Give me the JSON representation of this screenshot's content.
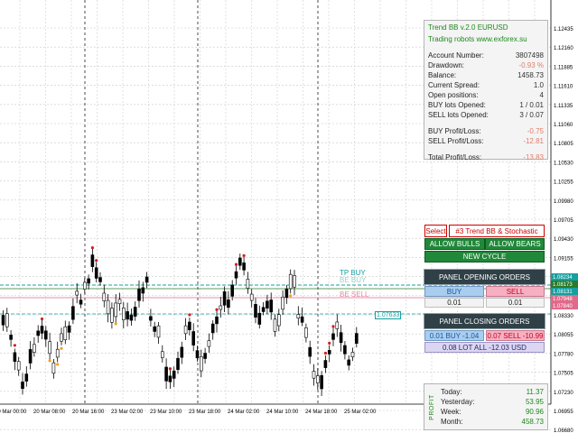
{
  "info_panel": {
    "title": "Trend BB v.2.0 EURUSD",
    "subtitle": "Trading robots www.exforex.su",
    "rows": [
      {
        "label": "Account Number:",
        "value": "3807498"
      },
      {
        "label": "Drawdown:",
        "value": "-0.93 %"
      },
      {
        "label": "Balance:",
        "value": "1458.73"
      },
      {
        "label": "Current Spread:",
        "value": "1.0"
      },
      {
        "label": "Open positions:",
        "value": "4"
      },
      {
        "label": "BUY lots Opened:",
        "value": "1 / 0.01"
      },
      {
        "label": "SELL lots Opened:",
        "value": "3 / 0.07"
      }
    ],
    "pl_rows": [
      {
        "label": "BUY Profit/Loss:",
        "value": "-0.75"
      },
      {
        "label": "SELL Profit/Loss:",
        "value": "-12.81"
      }
    ],
    "total": {
      "label": "Total Profit/Loss:",
      "value": "-13.83"
    }
  },
  "controls": {
    "select_label": "Select",
    "strategy_label": "#3 Trend BB & Stochastic",
    "allow_bulls": "ALLOW BULLS",
    "allow_bears": "ALLOW BEARS",
    "new_cycle": "NEW CYCLE"
  },
  "opening": {
    "header": "PANEL OPENING ORDERS",
    "buy": "BUY",
    "sell": "SELL",
    "buy_lot": "0.01",
    "sell_lot": "0.01"
  },
  "closing": {
    "header": "PANEL CLOSING ORDERS",
    "buy_close": "0.01 BUY  -1.04",
    "sell_close": "0.07 SELL  -10.99",
    "lot_all": "0.08 LOT     ALL     -12.03 USD"
  },
  "profit": {
    "vertical_label": "PROFIT",
    "rows": [
      {
        "label": "Today:",
        "value": "11.37"
      },
      {
        "label": "Yesterday:",
        "value": "53.95"
      },
      {
        "label": "Week:",
        "value": "90.96"
      },
      {
        "label": "Month:",
        "value": "458.73"
      }
    ]
  },
  "chart": {
    "price_labels": [
      "1.12435",
      "1.12160",
      "1.11885",
      "1.11610",
      "1.11335",
      "1.11060",
      "1.10805",
      "1.10530",
      "1.10255",
      "1.09980",
      "1.09705",
      "1.09430",
      "1.09155",
      "1.08880",
      "1.08605",
      "1.08330",
      "1.08055",
      "1.07780",
      "1.07505",
      "1.07230",
      "1.06955",
      "1.06680",
      "1.06405"
    ],
    "time_labels": [
      "20 Mar 00:00",
      "20 Mar 08:00",
      "20 Mar 16:00",
      "23 Mar 02:00",
      "23 Mar 10:00",
      "23 Mar 18:00",
      "24 Mar 02:00",
      "24 Mar 10:00",
      "24 Mar 18:00",
      "25 Mar 02:00"
    ],
    "markers": {
      "tp_buy": "TP BUY",
      "be_buy": "BE BUY",
      "be_sell": "BE SELL",
      "price_tag": "1.07633"
    },
    "right_tags": [
      "1.08234",
      "1.08173",
      "1.08131",
      "1.07948",
      "1.07840"
    ],
    "colors": {
      "tp_line": "#14a0a0",
      "be_sell": "#e06a8a",
      "bid": "#2a7a2a"
    }
  }
}
